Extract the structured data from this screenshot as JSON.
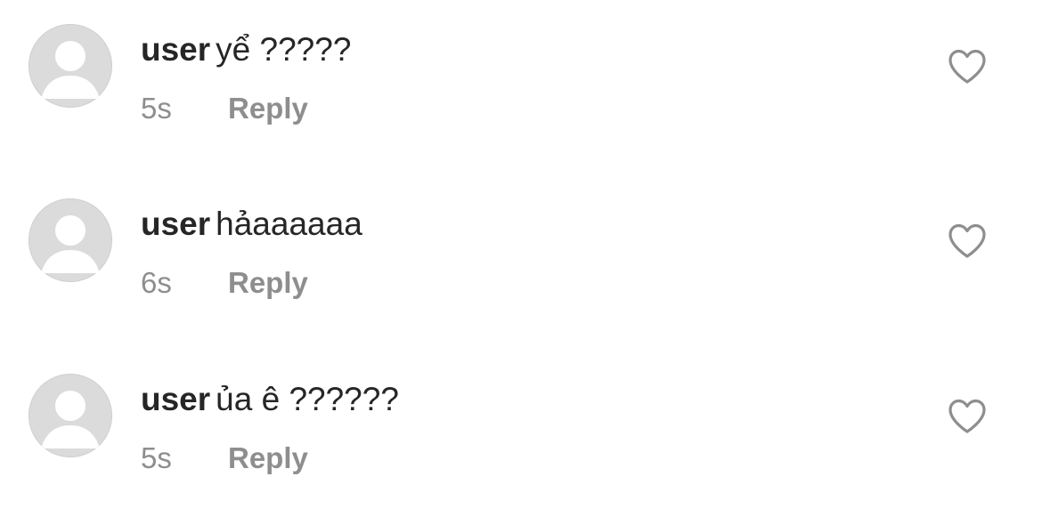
{
  "comments": [
    {
      "username": "user",
      "text": "yể ?????",
      "time": "5s",
      "reply_label": "Reply",
      "like_icon": "heart-outline-icon"
    },
    {
      "username": "user",
      "text": "hảaaaaaa",
      "time": "6s",
      "reply_label": "Reply",
      "like_icon": "heart-outline-icon"
    },
    {
      "username": "user",
      "text": "ủa ê ??????",
      "time": "5s",
      "reply_label": "Reply",
      "like_icon": "heart-outline-icon"
    }
  ],
  "colors": {
    "text_primary": "#262626",
    "text_secondary": "#8e8e8e",
    "avatar_bg": "#dbdbdb",
    "avatar_figure": "#ffffff"
  }
}
